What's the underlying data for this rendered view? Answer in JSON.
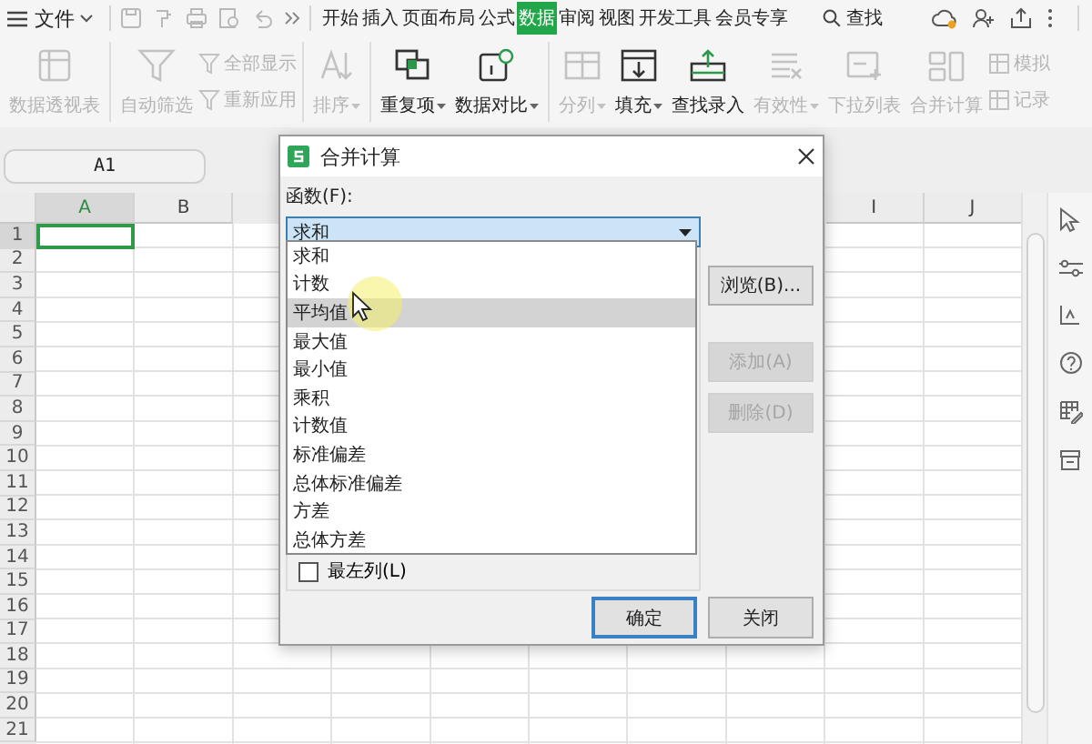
{
  "menu": {
    "file_label": "文件",
    "search_label": "查找",
    "tabs": [
      {
        "label": "开始",
        "selected": false
      },
      {
        "label": "插入",
        "selected": false
      },
      {
        "label": "页面布局",
        "selected": false
      },
      {
        "label": "公式",
        "selected": false
      },
      {
        "label": "数据",
        "selected": true
      },
      {
        "label": "审阅",
        "selected": false
      },
      {
        "label": "视图",
        "selected": false
      },
      {
        "label": "开发工具",
        "selected": false
      },
      {
        "label": "会员专享",
        "selected": false
      }
    ]
  },
  "ribbon_groups": [
    [
      {
        "kind": "large",
        "label": "数据透视表",
        "disabled": true,
        "dropdown": false
      }
    ],
    [
      {
        "kind": "large",
        "label": "自动筛选",
        "disabled": true,
        "dropdown": false
      },
      {
        "kind": "stack",
        "entries": [
          {
            "label": "全部显示",
            "disabled": true
          },
          {
            "label": "重新应用",
            "disabled": true
          }
        ]
      }
    ],
    [
      {
        "kind": "large",
        "label": "排序",
        "disabled": true,
        "dropdown": true
      }
    ],
    [
      {
        "kind": "large",
        "label": "重复项",
        "disabled": false,
        "dropdown": true
      },
      {
        "kind": "large",
        "label": "数据对比",
        "disabled": false,
        "dropdown": true
      }
    ],
    [
      {
        "kind": "large",
        "label": "分列",
        "disabled": true,
        "dropdown": true
      },
      {
        "kind": "large",
        "label": "填充",
        "disabled": false,
        "dropdown": true
      },
      {
        "kind": "large",
        "label": "查找录入",
        "disabled": false,
        "dropdown": false
      },
      {
        "kind": "large",
        "label": "有效性",
        "disabled": true,
        "dropdown": true
      },
      {
        "kind": "large",
        "label": "下拉列表",
        "disabled": true,
        "dropdown": false
      },
      {
        "kind": "large",
        "label": "合并计算",
        "disabled": true,
        "dropdown": false
      },
      {
        "kind": "stack",
        "entries": [
          {
            "label": "模拟",
            "disabled": true
          },
          {
            "label": "记录",
            "disabled": true
          }
        ]
      }
    ]
  ],
  "sheet": {
    "name_box": "A1",
    "columns": [
      {
        "label": "A"
      },
      {
        "label": "B"
      },
      {
        "label": "I"
      },
      {
        "label": "J"
      }
    ],
    "rows": [
      {
        "label": "1",
        "selected": true
      },
      {
        "label": "2",
        "selected": false
      },
      {
        "label": "3",
        "selected": false
      },
      {
        "label": "4",
        "selected": false
      },
      {
        "label": "5",
        "selected": false
      },
      {
        "label": "6",
        "selected": false
      },
      {
        "label": "7",
        "selected": false
      },
      {
        "label": "8",
        "selected": false
      },
      {
        "label": "9",
        "selected": false
      },
      {
        "label": "10",
        "selected": false
      },
      {
        "label": "11",
        "selected": false
      },
      {
        "label": "12",
        "selected": false
      },
      {
        "label": "13",
        "selected": false
      },
      {
        "label": "14",
        "selected": false
      },
      {
        "label": "15",
        "selected": false
      },
      {
        "label": "16",
        "selected": false
      },
      {
        "label": "17",
        "selected": false
      },
      {
        "label": "18",
        "selected": false
      },
      {
        "label": "19",
        "selected": false
      },
      {
        "label": "20",
        "selected": false
      },
      {
        "label": "21",
        "selected": false
      }
    ]
  },
  "dialog": {
    "title": "合并计算",
    "function_label": "函数(F):",
    "function_value": "求和",
    "options": [
      {
        "label": "求和",
        "selected": false
      },
      {
        "label": "计数",
        "selected": false
      },
      {
        "label": "平均值",
        "selected": true
      },
      {
        "label": "最大值",
        "selected": false
      },
      {
        "label": "最小值",
        "selected": false
      },
      {
        "label": "乘积",
        "selected": false
      },
      {
        "label": "计数值",
        "selected": false
      },
      {
        "label": "标准偏差",
        "selected": false
      },
      {
        "label": "总体标准偏差",
        "selected": false
      },
      {
        "label": "方差",
        "selected": false
      },
      {
        "label": "总体方差",
        "selected": false
      }
    ],
    "side_buttons": [
      {
        "label": "浏览(B)...",
        "disabled": false
      },
      {
        "label": "添加(A)",
        "disabled": true
      },
      {
        "label": "删除(D)",
        "disabled": true
      }
    ],
    "checkbox": {
      "label": "最左列(L)",
      "checked": false
    },
    "footer_buttons": [
      {
        "label": "确定",
        "default": true
      },
      {
        "label": "关闭",
        "default": false
      }
    ]
  }
}
